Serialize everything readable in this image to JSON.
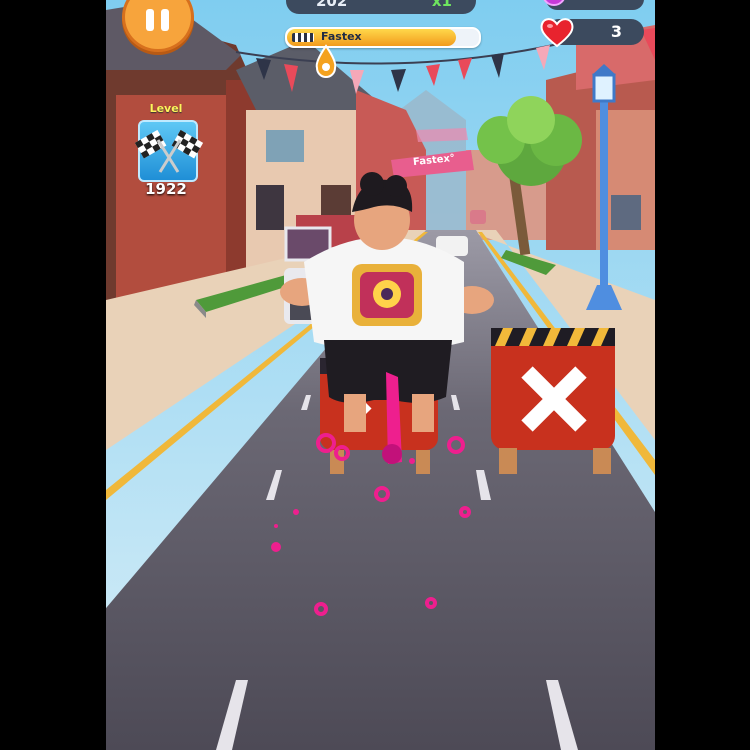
{
  "hud": {
    "score": "202",
    "multiplier": "x1",
    "progress_label": "Fastex",
    "progress_fraction": 0.88,
    "lives": "3"
  },
  "level": {
    "label": "Level",
    "number": "1922"
  },
  "scene": {
    "banner_text": "Fastex°"
  },
  "icons": {
    "pause": "pause-icon",
    "heart": "heart-icon",
    "flags": "checkered-flags-icon",
    "coin": "coin-icon"
  },
  "colors": {
    "road": "#55525f",
    "barrier_red": "#c8311e",
    "pause_orange": "#f7a43c",
    "trail_pink": "#ee1f8e"
  }
}
